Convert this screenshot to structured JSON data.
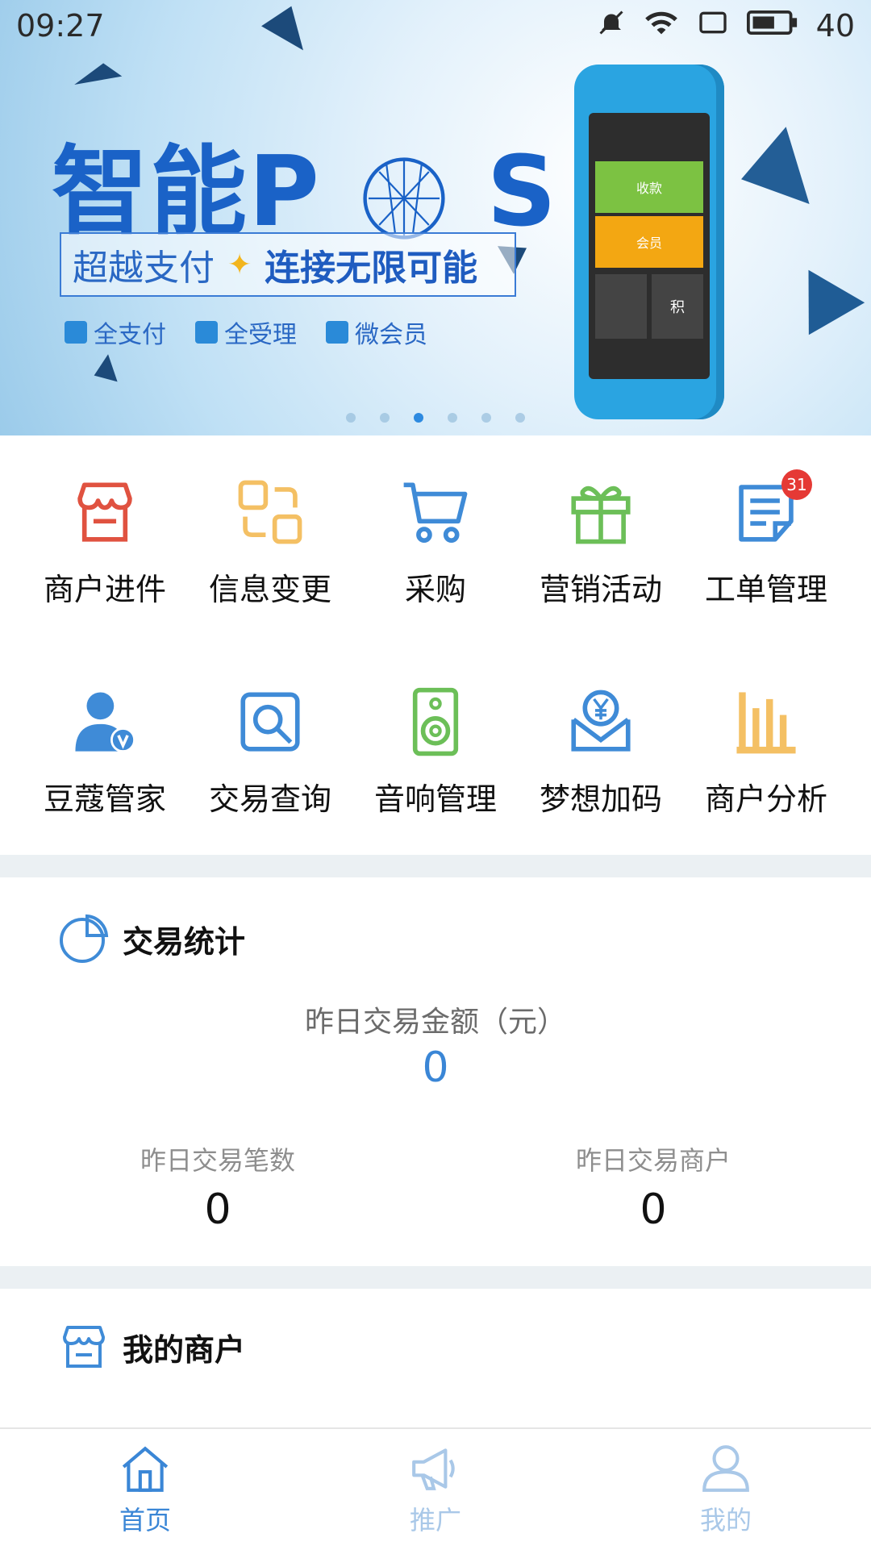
{
  "status_bar": {
    "time": "09:27",
    "battery": "40"
  },
  "banner": {
    "title_text": "智能P",
    "title_tail": "S",
    "slogan_left": "超越支付",
    "slogan_right": "连接无限可能",
    "features": [
      "全支付",
      "全受理",
      "微会员"
    ],
    "device_tiles": [
      "收款",
      "会员",
      "积"
    ],
    "dots_count": 6,
    "active_dot": 2
  },
  "grid": {
    "row1": [
      {
        "label": "商户进件",
        "icon": "store-icon",
        "color": "#e05240"
      },
      {
        "label": "信息变更",
        "icon": "exchange-icon",
        "color": "#f4c064"
      },
      {
        "label": "采购",
        "icon": "cart-icon",
        "color": "#3f8bd7"
      },
      {
        "label": "营销活动",
        "icon": "gift-icon",
        "color": "#6cbf58"
      },
      {
        "label": "工单管理",
        "icon": "worksheet-icon",
        "color": "#3f8bd7",
        "badge": "31"
      }
    ],
    "row2": [
      {
        "label": "豆蔻管家",
        "icon": "vip-user-icon",
        "color": "#3f8bd7"
      },
      {
        "label": "交易查询",
        "icon": "search-doc-icon",
        "color": "#3f8bd7"
      },
      {
        "label": "音响管理",
        "icon": "speaker-icon",
        "color": "#6cbf58"
      },
      {
        "label": "梦想加码",
        "icon": "yuan-envelope-icon",
        "color": "#3f8bd7"
      },
      {
        "label": "商户分析",
        "icon": "bar-chart-icon",
        "color": "#f4c064"
      }
    ]
  },
  "stats": {
    "section_title": "交易统计",
    "yesterday_amount_label": "昨日交易金额（元）",
    "yesterday_amount_value": "0",
    "yesterday_count_label": "昨日交易笔数",
    "yesterday_count_value": "0",
    "yesterday_merchants_label": "昨日交易商户",
    "yesterday_merchants_value": "0"
  },
  "merchants": {
    "section_title": "我的商户"
  },
  "nav": {
    "items": [
      {
        "label": "首页",
        "icon": "home-icon",
        "active": true
      },
      {
        "label": "推广",
        "icon": "megaphone-icon",
        "active": false
      },
      {
        "label": "我的",
        "icon": "user-icon",
        "active": false
      }
    ],
    "active_color": "#3a86d6",
    "inactive_color": "#a9c8e8"
  }
}
